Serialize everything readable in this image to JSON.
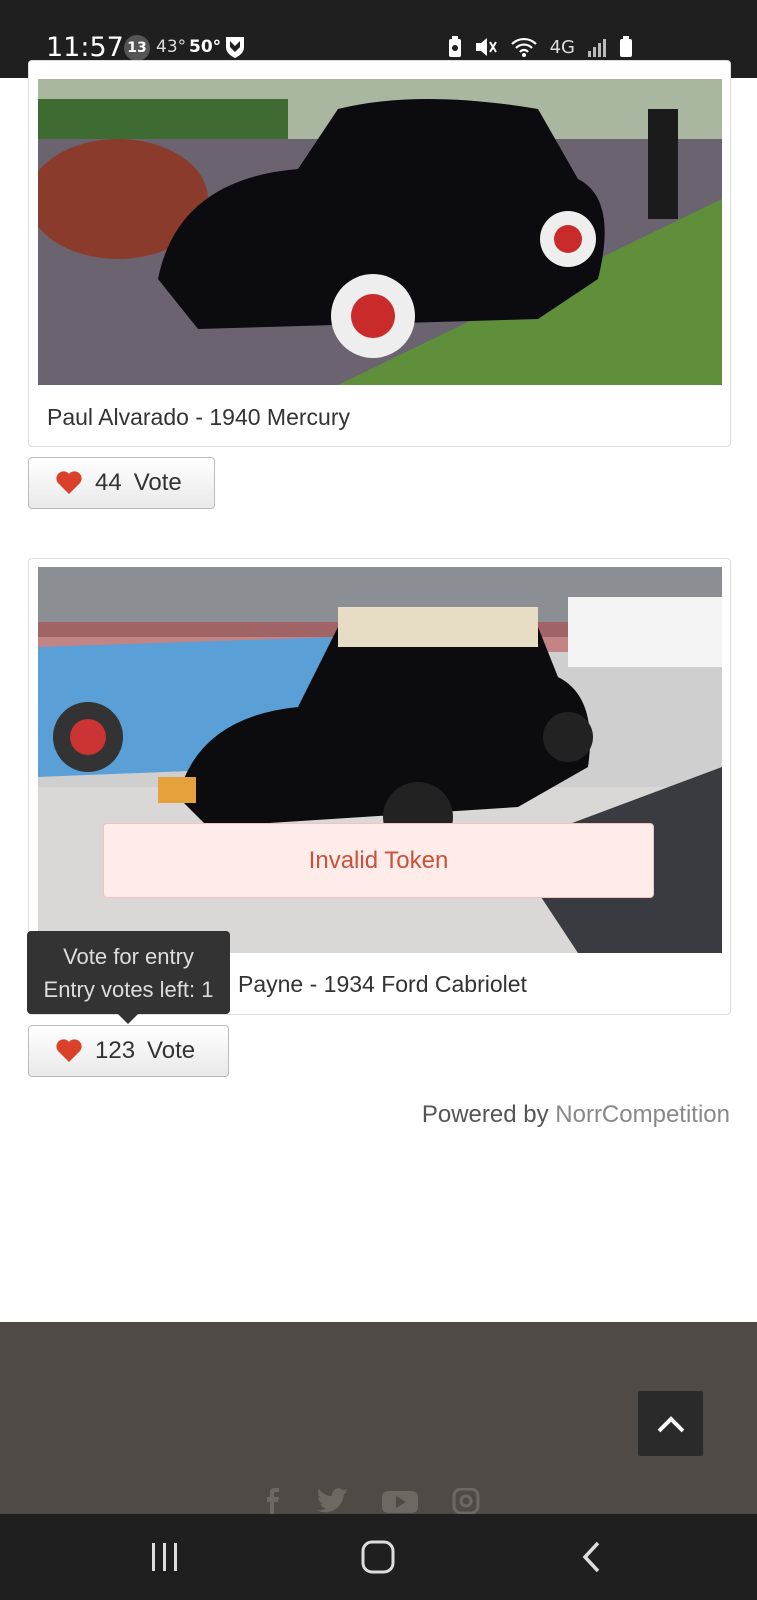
{
  "status": {
    "time": "11:57",
    "badge": "13",
    "temp_current": "43°",
    "temp_high": "50°",
    "network": "4G"
  },
  "entries": [
    {
      "caption": "Paul Alvarado - 1940 Mercury",
      "votes": "44",
      "vote_label": "Vote"
    },
    {
      "caption": "Payne - 1934 Ford Cabriolet",
      "votes": "123",
      "vote_label": "Vote"
    }
  ],
  "alert": {
    "message": "Invalid Token"
  },
  "tooltip": {
    "line1": "Vote for entry",
    "line2": "Entry votes left: 1"
  },
  "powered": {
    "prefix": "Powered by",
    "brand": "NorrCompetition"
  },
  "colors": {
    "heart": "#d9412b",
    "footer": "#4f4a46",
    "alert_text": "#c9513a"
  },
  "icons": {
    "footer": [
      "facebook-icon",
      "twitter-icon",
      "youtube-icon",
      "instagram-icon"
    ],
    "nav": [
      "recents-icon",
      "home-icon",
      "back-icon"
    ]
  }
}
